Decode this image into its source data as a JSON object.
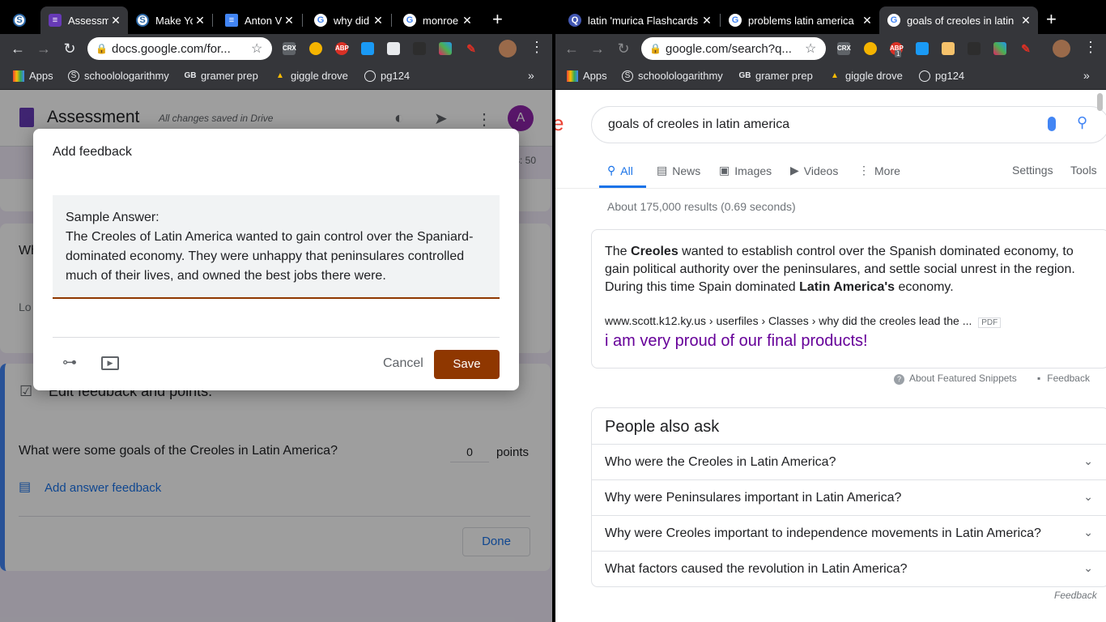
{
  "left": {
    "tabs": [
      {
        "label": "",
        "icon": "schoology-icon",
        "color": "#2b67a6"
      },
      {
        "label": "Assessm",
        "icon": "forms-icon",
        "color": "#673ab7"
      },
      {
        "label": "Make Yo",
        "icon": "schoology-icon",
        "color": "#2b67a6"
      },
      {
        "label": "Anton V",
        "icon": "docs-icon",
        "color": "#4285f4"
      },
      {
        "label": "why did",
        "icon": "google-icon",
        "color": "#ffffff"
      },
      {
        "label": "monroe",
        "icon": "google-icon",
        "color": "#ffffff"
      }
    ],
    "url": "docs.google.com/for...",
    "bookmarks": [
      "Apps",
      "schoolologarithmy",
      "gramer prep",
      "giggle drove",
      "pg124"
    ],
    "extensions": [
      "CRX",
      "ABP"
    ],
    "form": {
      "title": "Assessment",
      "saved": "All changes saved in Drive",
      "avatar": "A",
      "points_total_fragment": "s: 50",
      "question_fragment": "Wh",
      "long_answer_fragment": "Lo",
      "edit_feedback": "Edit feedback and points.",
      "question": "What were some goals of the Creoles in Latin America?",
      "points_value": "0",
      "points_label": "points",
      "add_answer_feedback": "Add answer feedback",
      "done": "Done"
    },
    "dialog": {
      "title": "Add feedback",
      "feedback_line1": "Sample Answer:",
      "feedback_line2": "The Creoles of Latin America wanted to gain control over the Spaniard-",
      "feedback_line3": "dominated economy. They were unhappy that peninsulares controlled",
      "feedback_line4": "much of their lives, and owned the best jobs there were.",
      "cancel": "Cancel",
      "save": "Save"
    }
  },
  "right": {
    "tabs": [
      {
        "label": "latin 'murica Flashcards",
        "icon": "quizlet-icon",
        "color": "#4257b2"
      },
      {
        "label": "problems latin america",
        "icon": "google-icon",
        "color": "#ffffff"
      },
      {
        "label": "goals of creoles in latin",
        "icon": "google-icon",
        "color": "#ffffff"
      }
    ],
    "url": "google.com/search?q...",
    "abp_badge": "1",
    "bookmarks": [
      "Apps",
      "schoolologarithmy",
      "gramer prep",
      "giggle drove",
      "pg124"
    ],
    "search": {
      "logo_fragment": "e",
      "query": "goals of creoles in latin america",
      "nav": [
        "All",
        "News",
        "Images",
        "Videos",
        "More"
      ],
      "settings": "Settings",
      "tools": "Tools",
      "result_stats": "About 175,000 results (0.69 seconds)",
      "snippet": {
        "p1": "The ",
        "b1": "Creoles",
        "p2": " wanted to establish control over the Spanish dominated economy, to",
        "line2": "gain political authority over the peninsulares, and settle social unrest in the region.",
        "p3": "During this time Spain dominated ",
        "b2": "Latin America's",
        "p4": " economy.",
        "cite": "www.scott.k12.ky.us › userfiles › Classes › why did the creoles lead the ...",
        "pdf": "PDF",
        "link": "i am very proud of our final products!"
      },
      "about_snippets": "About Featured Snippets",
      "feedback": "Feedback",
      "paa_title": "People also ask",
      "paa": [
        "Who were the Creoles in Latin America?",
        "Why were Peninsulares important in Latin America?",
        "Why were Creoles important to independence movements in Latin America?",
        "What factors caused the revolution in Latin America?"
      ],
      "paa_feedback": "Feedback"
    }
  },
  "colors": {
    "save_btn": "#8f3700",
    "link_blue": "#1a73e8",
    "visited": "#660099"
  }
}
